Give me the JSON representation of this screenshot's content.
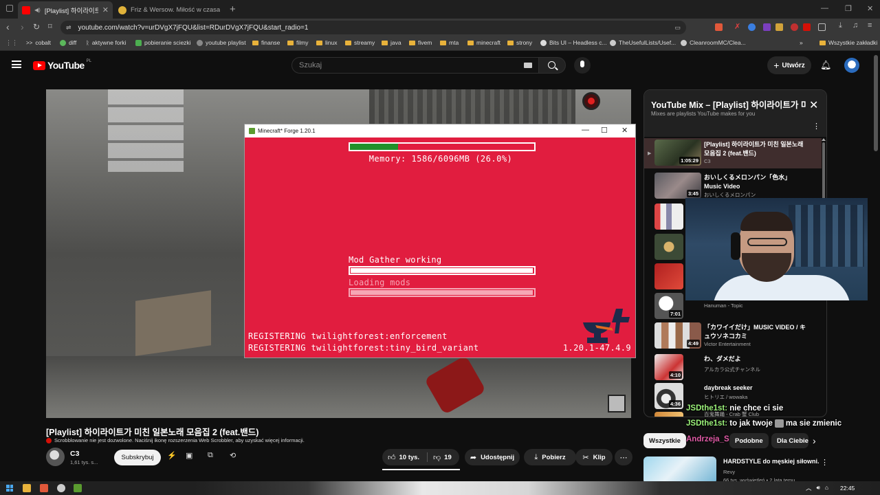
{
  "browser": {
    "tabs": [
      {
        "label": "[Playlist] 하이라이트가 미친",
        "active": true
      },
      {
        "label": "Friz & Wersow. Miłość w czasach onl",
        "active": false
      }
    ],
    "url": "youtube.com/watch?v=urDVgX7jFQU&list=RDurDVgX7jFQU&start_radio=1",
    "bookmarks": [
      "cobalt",
      "diff",
      "aktywne forki",
      "pobieranie sciezki",
      "youtube playlist",
      "finanse",
      "filmy",
      "linux",
      "streamy",
      "java",
      "fivem",
      "mta",
      "minecraft",
      "strony",
      "Bits UI – Headless c...",
      "TheUsefulLists/Usef...",
      "CleanroomMC/Clea..."
    ],
    "bookmarks_all": "Wszystkie zakładki",
    "bookmarks_more": "»"
  },
  "youtube": {
    "logo": "YouTube",
    "region": "PL",
    "search_placeholder": "Szukaj",
    "create_label": "Utwórz"
  },
  "minecraft": {
    "window_title": "Minecraft* Forge 1.20.1",
    "memory_text": "Memory: 1586/6096MB (26.0%)",
    "memory_fraction": 0.26,
    "mod_status": "Mod Gather working",
    "mod_progress": 0.99,
    "loading_text": "Loading mods",
    "loading_progress": 0.99,
    "register_lines": [
      "REGISTERING twilightforest:enforcement",
      "REGISTERING twilightforest:tiny_bird_variant"
    ],
    "version": "1.20.1-47.4.9"
  },
  "video": {
    "title": "[Playlist] 하이라이트가 미친 일본노래 모음집 2 (feat.밴드)",
    "scrobbler_note": "Scrobblowanie nie jest dozwolone. Naciśnij ikonę rozszerzenia Web Scrobbler, aby uzyskać więcej informacji.",
    "channel": "C3",
    "subscribers": "1,61 tys. s...",
    "subscribe_label": "Subskrybuj",
    "likes": "10 tys.",
    "dislikes": "19",
    "share_label": "Udostępnij",
    "download_label": "Pobierz",
    "clip_label": "Klip"
  },
  "playlist": {
    "title": "YouTube Mix – [Playlist] 하이라이트가 미친 일본노래",
    "subtitle": "Mixes are playlists YouTube makes for you",
    "items": [
      {
        "title": "[Playlist] 하이라이트가 미친 일본노래 모음집 2 (feat.밴드)",
        "channel": "C3",
        "duration": "1:05:29",
        "current": true
      },
      {
        "title": "おいしくるメロンパン「色水」Music Video",
        "channel": "おいしくるメロンパン",
        "duration": "3:45"
      },
      {
        "title": "",
        "channel": "",
        "duration": ""
      },
      {
        "title": "",
        "channel": "",
        "duration": ""
      },
      {
        "title": "",
        "channel": "",
        "duration": ""
      },
      {
        "title": "",
        "channel": "Hanuman - Topic",
        "duration": "7:01"
      },
      {
        "title": "「カワイイだけ」MUSIC VIDEO / キュウソネコカミ",
        "channel": "Victor Entertainment",
        "duration": "4:49"
      },
      {
        "title": "わ、ダメだよ",
        "channel": "アルカラ公式チャンネル",
        "duration": "4:10"
      },
      {
        "title": "daybreak seeker",
        "channel": "ヒトリエ / wowaka",
        "duration": "4:36"
      },
      {
        "title": "",
        "channel": "百鬼舞踊 - Crab 蟹 Club",
        "duration": ""
      }
    ]
  },
  "chat": [
    {
      "user": "JSDthe1st:",
      "message": "nie chce ci sie"
    },
    {
      "user": "JSDthe1st:",
      "message_before": "to jak twoje",
      "message_after": "ma sie zmienic"
    }
  ],
  "overlay_name": "Andrzeja_S",
  "chips": [
    "Wszystkie",
    "Podobne",
    "Dla Ciebie"
  ],
  "recommendation": {
    "title": "HARDSTYLE do męskiej siłowni.",
    "channel": "Revy",
    "meta": "66 tys. wyświetleń • 2 lata temu"
  },
  "taskbar": {
    "clock": "22:45"
  },
  "colors": {
    "mc_red": "#e11d3f",
    "mc_green": "#21902a",
    "yt_red": "#ff0000",
    "chat_user": "#9cf27a"
  }
}
